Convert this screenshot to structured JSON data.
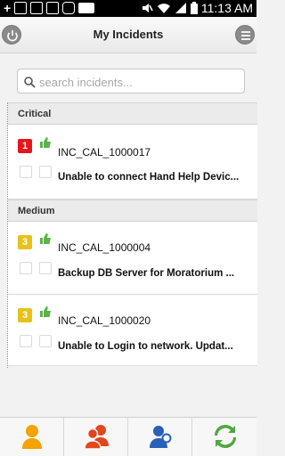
{
  "status_bar": {
    "time": "11:13 AM",
    "left_icons": [
      "plus-icon",
      "gmail-icon",
      "image-icon",
      "play-icon",
      "viber-icon",
      "dominos-icon"
    ],
    "right_icons": [
      "mute-icon",
      "wifi-icon",
      "signal-icon",
      "battery-icon"
    ]
  },
  "header": {
    "title": "My Incidents",
    "left_icon": "power-icon",
    "right_icon": "menu-icon"
  },
  "search": {
    "placeholder": "search incidents...",
    "value": ""
  },
  "sections": [
    {
      "label": "Critical",
      "incidents": [
        {
          "priority": "1",
          "priority_color": "#e8141c",
          "id": "INC_CAL_1000017",
          "description": "Unable to connect Hand Help Devic..."
        }
      ]
    },
    {
      "label": "Medium",
      "incidents": [
        {
          "priority": "3",
          "priority_color": "#e8c21a",
          "id": "INC_CAL_1000004",
          "description": "Backup DB Server for Moratorium ..."
        },
        {
          "priority": "3",
          "priority_color": "#e8c21a",
          "id": "INC_CAL_1000020",
          "description": "Unable to Login to network. Updat..."
        }
      ]
    }
  ],
  "bottom_tabs": [
    {
      "name": "my-incidents-tab",
      "icon": "single-user-icon",
      "color": "#f5a300"
    },
    {
      "name": "team-incidents-tab",
      "icon": "group-users-icon",
      "color": "#e2461b"
    },
    {
      "name": "search-user-tab",
      "icon": "user-search-icon",
      "color": "#2a5fb8"
    },
    {
      "name": "sync-tab",
      "icon": "sync-arrows-icon",
      "color": "#4ea842"
    }
  ],
  "colors": {
    "thumb_green": "#5cb34a"
  }
}
